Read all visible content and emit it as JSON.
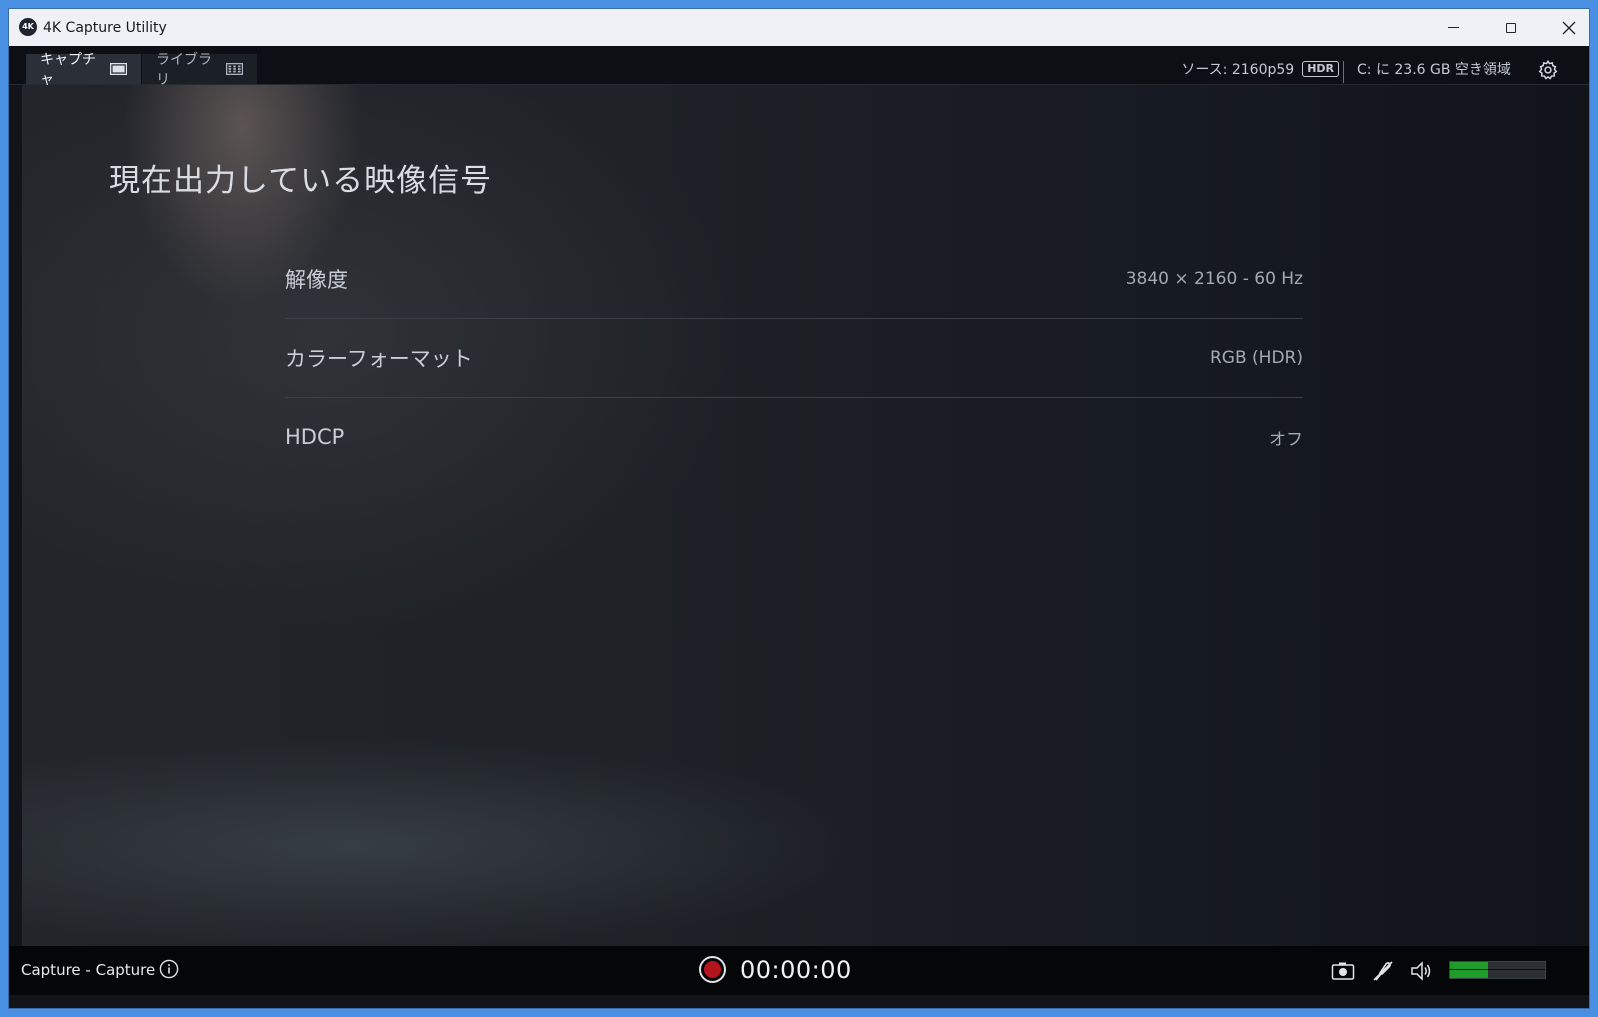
{
  "window": {
    "title": "4K Capture Utility",
    "logo_text": "4K"
  },
  "tabs": [
    {
      "label": "キャプチャ",
      "icon": "capture-screen-icon",
      "active": true
    },
    {
      "label": "ライブラリ",
      "icon": "library-grid-icon",
      "active": false
    }
  ],
  "header": {
    "source": "ソース: 2160p59",
    "hdr_badge": "HDR",
    "disk": "C: に 23.6 GB 空き領域"
  },
  "main": {
    "title": "現在出力している映像信号",
    "rows": [
      {
        "label": "解像度",
        "value": "3840 × 2160 - 60 Hz"
      },
      {
        "label": "カラーフォーマット",
        "value": "RGB (HDR)"
      },
      {
        "label": "HDCP",
        "value": "オフ"
      }
    ]
  },
  "statusbar": {
    "mode": "Capture - Capture",
    "timer": "00:00:00",
    "audio_level": 0.4
  },
  "colors": {
    "record": "#b4141c",
    "level": "#1e9d2b",
    "window_frame": "#4a90e2"
  }
}
